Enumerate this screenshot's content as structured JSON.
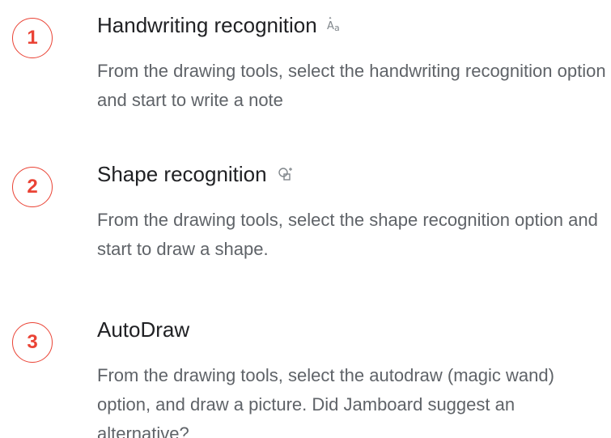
{
  "colors": {
    "accent": "#ea4335",
    "title_text": "#202124",
    "body_text": "#5f6368",
    "icon": "#80868b"
  },
  "steps": [
    {
      "number": "1",
      "title": "Handwriting recognition",
      "icon": "handwriting-recognition-icon",
      "description": "From the drawing tools, select the handwriting recognition option and start to write a note"
    },
    {
      "number": "2",
      "title": "Shape recognition",
      "icon": "shape-recognition-icon",
      "description": "From the drawing tools, select the shape recognition option and start to draw a shape."
    },
    {
      "number": "3",
      "title": "AutoDraw",
      "icon": "",
      "description": "From the drawing tools, select the autodraw (magic wand) option, and draw a picture. Did Jamboard suggest an alternative?"
    }
  ]
}
